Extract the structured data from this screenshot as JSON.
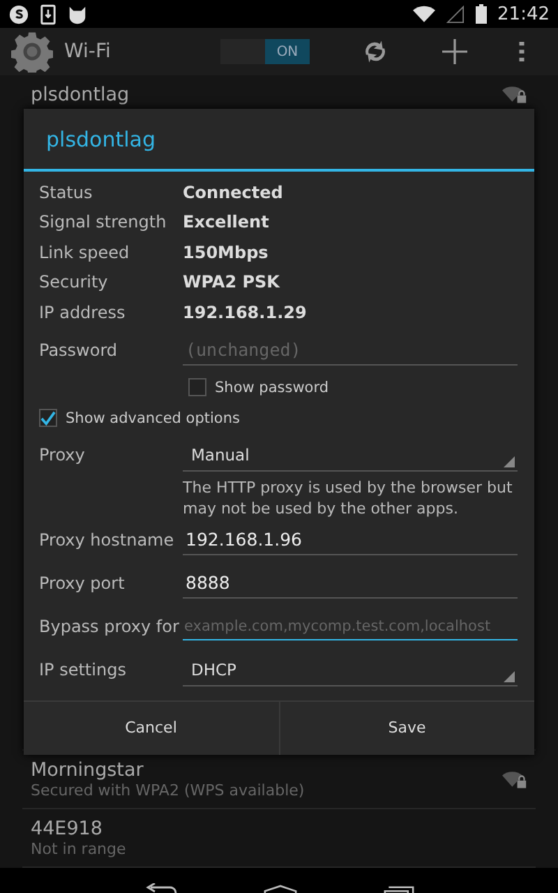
{
  "status_bar": {
    "time": "21:42"
  },
  "action_bar": {
    "title": "Wi-Fi",
    "toggle": {
      "label": "ON",
      "on": true
    }
  },
  "networks": [
    {
      "name": "plsdontlag",
      "locked": true
    },
    {
      "name": "Morningstar",
      "subtitle": "Secured with WPA2 (WPS available)",
      "locked": true
    },
    {
      "name": "44E918",
      "subtitle": "Not in range",
      "locked": false
    }
  ],
  "dialog": {
    "title": "plsdontlag",
    "info": [
      {
        "label": "Status",
        "value": "Connected"
      },
      {
        "label": "Signal strength",
        "value": "Excellent"
      },
      {
        "label": "Link speed",
        "value": "150Mbps"
      },
      {
        "label": "Security",
        "value": "WPA2 PSK"
      },
      {
        "label": "IP address",
        "value": "192.168.1.29"
      }
    ],
    "password": {
      "label": "Password",
      "placeholder": "(unchanged)"
    },
    "show_password": {
      "label": "Show password",
      "checked": false
    },
    "advanced": {
      "label": "Show advanced options",
      "checked": true
    },
    "fields": [
      {
        "kind": "dropdown",
        "label": "Proxy",
        "value": "Manual"
      },
      {
        "kind": "note",
        "text": "The HTTP proxy is used by the browser but may not be used by the other apps."
      },
      {
        "kind": "text",
        "label": "Proxy hostname",
        "value": "192.168.1.96",
        "focused": false
      },
      {
        "kind": "text",
        "label": "Proxy port",
        "value": "8888",
        "focused": false
      },
      {
        "kind": "text",
        "label": "Bypass proxy for",
        "placeholder": "example.com,mycomp.test.com,localhost",
        "focused": true
      },
      {
        "kind": "dropdown",
        "label": "IP settings",
        "value": "DHCP"
      }
    ],
    "buttons": [
      "Cancel",
      "Save"
    ]
  }
}
